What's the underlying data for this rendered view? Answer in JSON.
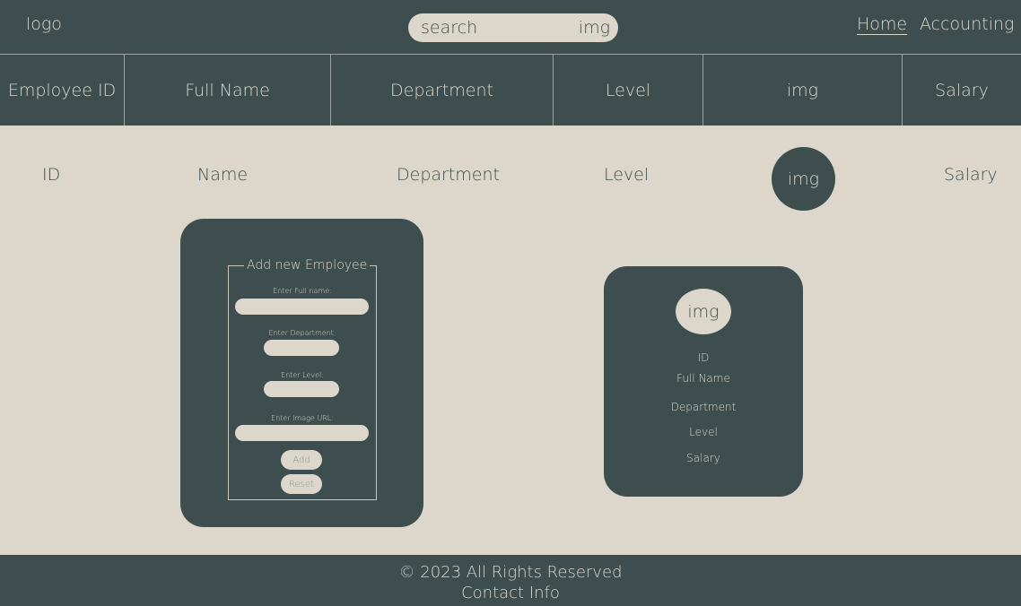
{
  "header": {
    "logo": "logo",
    "search": {
      "text": "search",
      "img": "img"
    },
    "nav": [
      {
        "label": "Home"
      },
      {
        "label": "Accounting"
      }
    ]
  },
  "table": {
    "columns": [
      "Employee ID",
      "Full Name",
      "Department",
      "Level",
      "img",
      "Salary"
    ],
    "rows": [
      {
        "id": "ID",
        "name": "Name",
        "department": "Department",
        "level": "Level",
        "img": "img",
        "salary": "Salary"
      }
    ]
  },
  "form": {
    "legend": "Add new Employee",
    "fields": [
      {
        "label": "Enter Full name:"
      },
      {
        "label": "Enter Department:"
      },
      {
        "label": "Enter Level:"
      },
      {
        "label": "Enter Image URL:"
      }
    ],
    "add_label": "Add",
    "reset_label": "Reset"
  },
  "profile": {
    "img": "img",
    "id": "ID",
    "full_name": "Full Name",
    "department": "Department",
    "level": "Level",
    "salary": "Salary"
  },
  "footer": {
    "copyright": "© 2023 All Rights Reserved",
    "contact": "Contact Info"
  },
  "colors": {
    "primary": "#3E4E4F",
    "background": "#DCD7CA"
  }
}
